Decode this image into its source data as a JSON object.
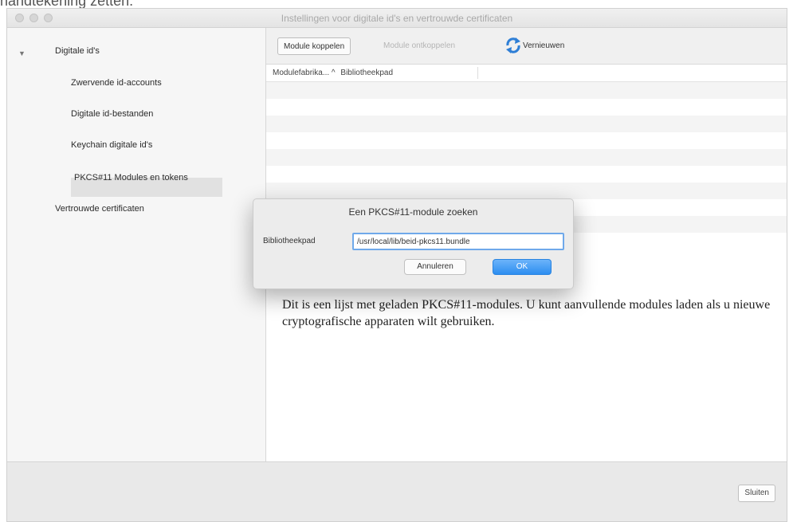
{
  "caption_fragment": "handtekening zetten.",
  "window": {
    "title": "Instellingen voor digitale id's en vertrouwde certificaten"
  },
  "sidebar": {
    "items": [
      {
        "label": "Digitale id's"
      },
      {
        "label": "Zwervende id-accounts"
      },
      {
        "label": "Digitale id-bestanden"
      },
      {
        "label": "Keychain digitale id's"
      },
      {
        "label": "PKCS#11 Modules en tokens"
      },
      {
        "label": "Vertrouwde certificaten"
      }
    ]
  },
  "toolbar": {
    "attach_label": "Module koppelen",
    "detach_label": "Module ontkoppelen",
    "refresh_label": "Vernieuwen"
  },
  "table": {
    "columns": [
      "Modulefabrika... ^",
      "Bibliotheekpad"
    ]
  },
  "description": "Dit is een lijst met geladen PKCS#11-modules. U kunt aanvullende modules laden als u nieuwe cryptografische apparaten wilt gebruiken.",
  "dialog": {
    "title": "Een PKCS#11-module zoeken",
    "field_label": "Bibliotheekpad",
    "field_value": "/usr/local/lib/beid-pkcs11.bundle",
    "cancel_label": "Annuleren",
    "ok_label": "OK"
  },
  "footer": {
    "close_label": "Sluiten"
  },
  "colors": {
    "accent": "#3b96f3",
    "selection": "#e1e1e1",
    "refresh_icon": "#2f7fd6"
  },
  "icons": [
    "disclosure-triangle-icon",
    "refresh-icon"
  ]
}
